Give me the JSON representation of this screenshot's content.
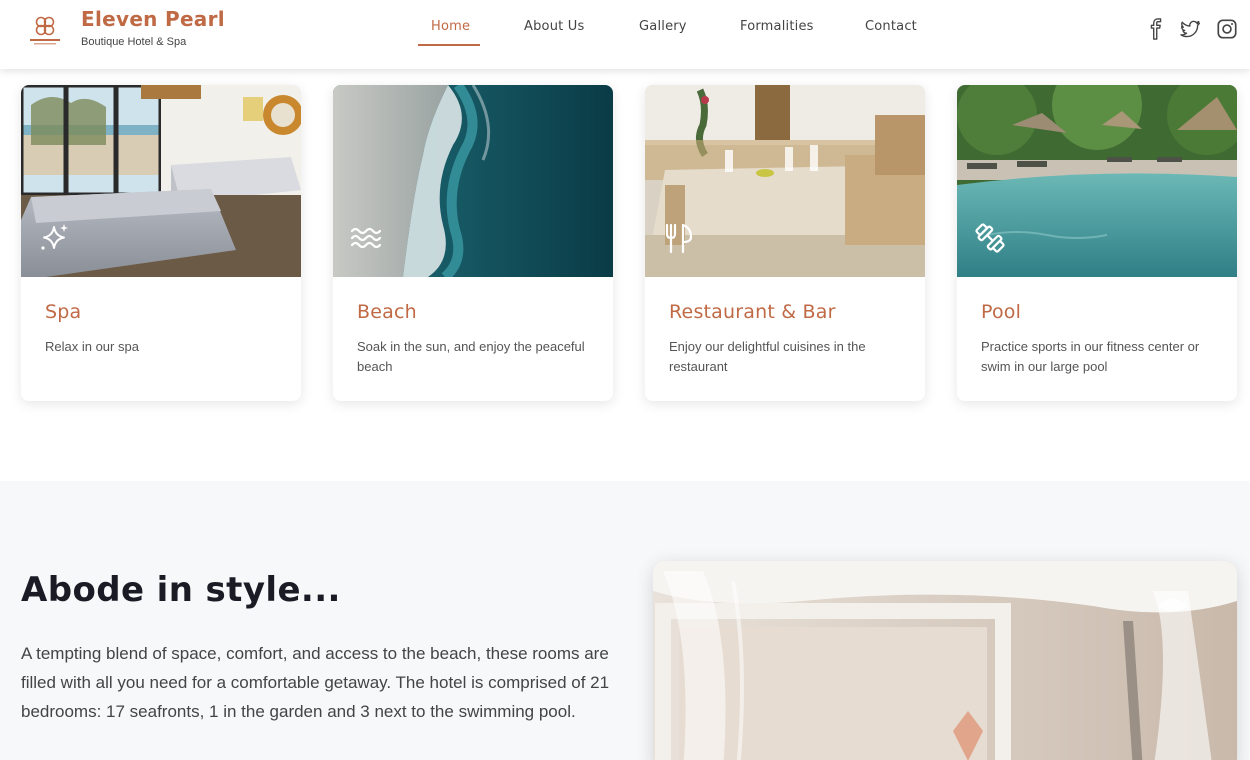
{
  "brand": {
    "name": "Eleven Pearl",
    "tagline": "Boutique Hotel & Spa",
    "logo_icon": "knot-logo-icon",
    "accent_color": "#c06a45"
  },
  "nav": {
    "items": [
      {
        "label": "Home",
        "active": true
      },
      {
        "label": "About Us",
        "active": false
      },
      {
        "label": "Gallery",
        "active": false
      },
      {
        "label": "Formalities",
        "active": false
      },
      {
        "label": "Contact",
        "active": false
      }
    ]
  },
  "social": [
    "facebook-icon",
    "twitter-icon",
    "instagram-icon"
  ],
  "cards": [
    {
      "title": "Spa",
      "description": "Relax in our spa",
      "icon": "sparkles-icon"
    },
    {
      "title": "Beach",
      "description": "Soak in the sun, and enjoy the peaceful beach",
      "icon": "waves-icon"
    },
    {
      "title": "Restaurant & Bar",
      "description": "Enjoy our delightful cuisines in the restaurant",
      "icon": "utensils-icon"
    },
    {
      "title": "Pool",
      "description": "Practice sports in our fitness center or swim in our large pool",
      "icon": "dumbbell-icon"
    }
  ],
  "abode": {
    "title": "Abode in style...",
    "text": "A tempting blend of space, comfort, and access to the beach, these rooms are filled with all you need for a comfortable getaway. The hotel is comprised of 21 bedrooms: 17 seafronts, 1 in the garden and 3 next to the swimming pool."
  }
}
